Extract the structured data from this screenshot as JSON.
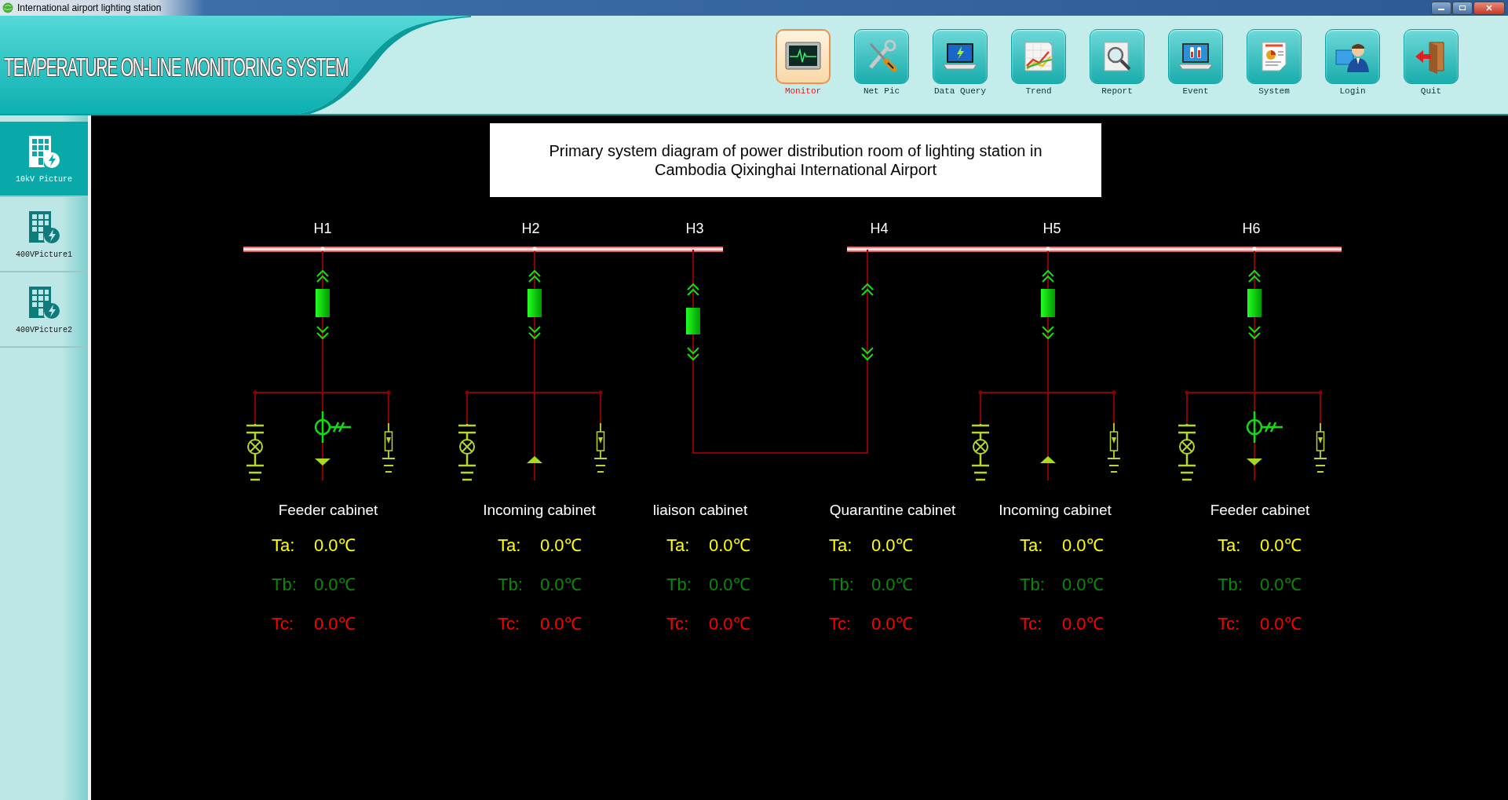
{
  "window": {
    "title": "International airport lighting station"
  },
  "header": {
    "title": "TEMPERATURE ON-LINE MONITORING SYSTEM"
  },
  "toolbar": [
    {
      "label": "Monitor",
      "selected": true
    },
    {
      "label": "Net Pic",
      "selected": false
    },
    {
      "label": "Data Query",
      "selected": false
    },
    {
      "label": "Trend",
      "selected": false
    },
    {
      "label": "Report",
      "selected": false
    },
    {
      "label": "Event",
      "selected": false
    },
    {
      "label": "System",
      "selected": false
    },
    {
      "label": "Login",
      "selected": false
    },
    {
      "label": "Quit",
      "selected": false
    }
  ],
  "sidebar": {
    "items": [
      {
        "label": "10kV Picture",
        "selected": true
      },
      {
        "label": "400VPicture1",
        "selected": false
      },
      {
        "label": "400VPicture2",
        "selected": false
      }
    ]
  },
  "diagram": {
    "title": "Primary system diagram of power distribution room of lighting station in Cambodia Qixinghai International Airport",
    "sections": [
      {
        "cabinets": [
          {
            "bay": "H1",
            "name": "Feeder cabinet",
            "kind": "feeder",
            "readings": [
              {
                "phase": "Ta:",
                "value": "0.0℃",
                "color": "#ffff00"
              },
              {
                "phase": "Tb:",
                "value": "0.0℃",
                "color": "#0a8a0a"
              },
              {
                "phase": "Tc:",
                "value": "0.0℃",
                "color": "#ff0000"
              }
            ]
          },
          {
            "bay": "H2",
            "name": "Incoming cabinet",
            "kind": "incoming",
            "readings": [
              {
                "phase": "Ta:",
                "value": "0.0℃",
                "color": "#ffff00"
              },
              {
                "phase": "Tb:",
                "value": "0.0℃",
                "color": "#0a8a0a"
              },
              {
                "phase": "Tc:",
                "value": "0.0℃",
                "color": "#ff0000"
              }
            ]
          },
          {
            "bay": "H3",
            "name": "liaison cabinet",
            "kind": "tie",
            "readings": [
              {
                "phase": "Ta:",
                "value": "0.0℃",
                "color": "#ffff00"
              },
              {
                "phase": "Tb:",
                "value": "0.0℃",
                "color": "#0a8a0a"
              },
              {
                "phase": "Tc:",
                "value": "0.0℃",
                "color": "#ff0000"
              }
            ]
          }
        ]
      },
      {
        "cabinets": [
          {
            "bay": "H4",
            "name": "Quarantine cabinet",
            "kind": "riser",
            "readings": [
              {
                "phase": "Ta:",
                "value": "0.0℃",
                "color": "#ffff00"
              },
              {
                "phase": "Tb:",
                "value": "0.0℃",
                "color": "#0a8a0a"
              },
              {
                "phase": "Tc:",
                "value": "0.0℃",
                "color": "#ff0000"
              }
            ]
          },
          {
            "bay": "H5",
            "name": "Incoming cabinet",
            "kind": "incoming",
            "readings": [
              {
                "phase": "Ta:",
                "value": "0.0℃",
                "color": "#ffff00"
              },
              {
                "phase": "Tb:",
                "value": "0.0℃",
                "color": "#0a8a0a"
              },
              {
                "phase": "Tc:",
                "value": "0.0℃",
                "color": "#ff0000"
              }
            ]
          },
          {
            "bay": "H6",
            "name": "Feeder cabinet",
            "kind": "feeder",
            "readings": [
              {
                "phase": "Ta:",
                "value": "0.0℃",
                "color": "#ffff00"
              },
              {
                "phase": "Tb:",
                "value": "0.0℃",
                "color": "#0a8a0a"
              },
              {
                "phase": "Tc:",
                "value": "0.0℃",
                "color": "#ff0000"
              }
            ]
          }
        ]
      }
    ]
  }
}
